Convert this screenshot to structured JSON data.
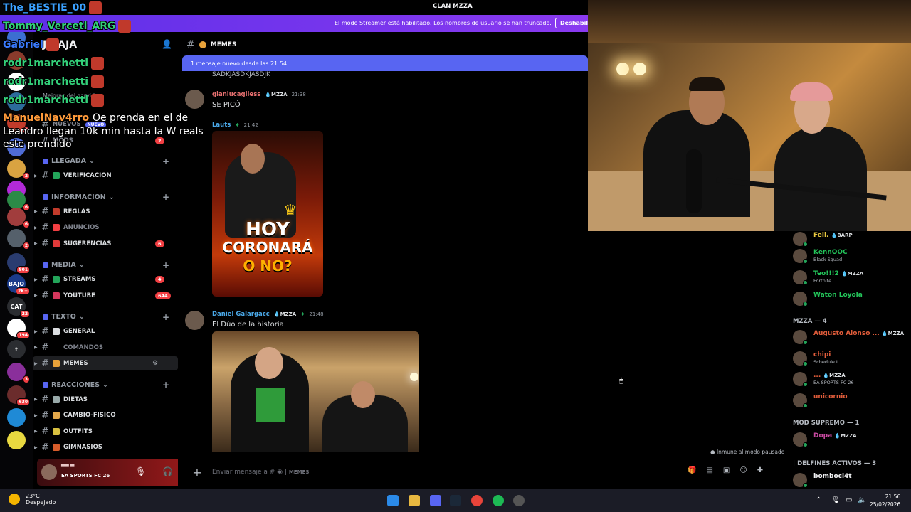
{
  "window": {
    "title": "CLAN MZZA"
  },
  "streamer_banner": {
    "message": "El modo Streamer está habilitado. Los nombres de usuario se han truncado.",
    "button": "Deshabili"
  },
  "server": {
    "name": "JAJAJA",
    "rail": [
      {
        "label": "",
        "badge": "",
        "color": "#3c6fd1"
      },
      {
        "label": "",
        "badge": "",
        "color": "#8a3b2c"
      },
      {
        "label": "",
        "badge": "",
        "color": "#ffffff"
      },
      {
        "label": "",
        "badge": "",
        "color": "#2c6b9b"
      },
      {
        "label": "",
        "badge": "6",
        "color": "#c23b2b"
      },
      {
        "label": "",
        "badge": "",
        "color": "#4f6cd6"
      },
      {
        "label": "",
        "badge": "2",
        "color": "#d9a341"
      },
      {
        "label": "",
        "badge": "",
        "color": "#b22ad8"
      },
      {
        "label": "",
        "badge": "6",
        "color": "#2b8a47"
      },
      {
        "label": "",
        "badge": "6",
        "color": "#a13d3d"
      },
      {
        "label": "",
        "badge": "2",
        "color": "#55606b"
      },
      {
        "label": "",
        "badge": "801",
        "color": "#2a3c70"
      },
      {
        "label": "BAJO",
        "badge": "2K+",
        "color": "#1b3b8a"
      },
      {
        "label": "CAT",
        "badge": "22",
        "color": "#2b2d31"
      },
      {
        "label": "",
        "badge": "194",
        "color": "#ffffff"
      },
      {
        "label": "t",
        "badge": "",
        "color": "#2b2d31"
      },
      {
        "label": "",
        "badge": "3",
        "color": "#8a2f9b"
      },
      {
        "label": "",
        "badge": "630",
        "color": "#6b2c2c"
      },
      {
        "label": "",
        "badge": "",
        "color": "#1f8ad6"
      },
      {
        "label": "",
        "badge": "",
        "color": "#e8d840"
      }
    ],
    "partial_rows": [
      "Mejoras del servidor"
    ],
    "categories": [
      {
        "name": "LLEGADA",
        "channels": [
          {
            "name": "VERIFICACION",
            "color": "#23a55a",
            "count": "",
            "dim": false
          }
        ]
      },
      {
        "name": "INFORMACION",
        "channels": [
          {
            "name": "REGLAS",
            "color": "#c23b2b",
            "count": "",
            "dim": false
          },
          {
            "name": "ANUNCIOS",
            "color": "#f23f43",
            "count": "",
            "dim": true
          },
          {
            "name": "SUGERENCIAS",
            "color": "#e03a3a",
            "count": "6",
            "dim": false
          }
        ]
      },
      {
        "name": "MEDIA",
        "channels": [
          {
            "name": "STREAMS",
            "color": "#23a55a",
            "count": "4",
            "dim": false
          },
          {
            "name": "YOUTUBE",
            "color": "#d4365c",
            "count": "644",
            "dim": false
          }
        ]
      },
      {
        "name": "TEXTO",
        "channels": [
          {
            "name": "GENERAL",
            "color": "#dbdee1",
            "count": "",
            "dim": false
          },
          {
            "name": "COMANDOS",
            "color": "#000000",
            "count": "",
            "dim": true
          },
          {
            "name": "MEMES",
            "color": "#e8a23a",
            "count": "",
            "dim": false
          }
        ]
      },
      {
        "name": "REACCIONES",
        "channels": [
          {
            "name": "DIETAS",
            "color": "#9aa",
            "count": "",
            "dim": false
          },
          {
            "name": "CAMBIO-FISICO",
            "color": "#e3a84a",
            "count": "",
            "dim": false
          },
          {
            "name": "OUTFITS",
            "color": "#d8c040",
            "count": "",
            "dim": false
          },
          {
            "name": "GIMNASIOS",
            "color": "#d65c2a",
            "count": "",
            "dim": false
          }
        ]
      }
    ],
    "extra_channels": [
      {
        "name": "NUEVOS",
        "badge": "NUEVO"
      },
      {
        "name": "MODS",
        "badge": "2"
      }
    ]
  },
  "user_panel": {
    "activity": "EA SPORTS FC 26"
  },
  "channel": {
    "name": "MEMES",
    "new_messages_bar": "1 mensaje nuevo desde las 21:54",
    "clipped_text": "SADKJASDKJASDJK",
    "composer_placeholder": "Enviar mensaje a #",
    "composer_channel": "MEMES"
  },
  "messages": [
    {
      "author": "gianlucagiless",
      "author_color": "#e87070",
      "tag": "MZZA",
      "time": "21:38",
      "text": "SE PICÓ"
    },
    {
      "author": "Lauts",
      "author_color": "#4aa8e8",
      "tag": "",
      "time": "21:42",
      "text": "",
      "image_text": [
        "HOY",
        "CORONARÁ",
        "O NO?"
      ]
    },
    {
      "author": "Daniel Galargacc",
      "author_color": "#4aa8e8",
      "tag": "MZZA",
      "time": "21:48",
      "text": "El Dúo de la historia"
    }
  ],
  "members": {
    "top": [
      {
        "name": "Feli.",
        "sub": "",
        "tag": "BARP",
        "color": "#e8c840"
      },
      {
        "name": "KennOOC",
        "sub": "Black Squad",
        "tag": "",
        "color": "#23c55a"
      },
      {
        "name": "Teo!!!2",
        "sub": "Fortnite",
        "tag": "MZZA",
        "color": "#23c55a"
      },
      {
        "name": "Waton Loyola",
        "sub": "",
        "tag": "",
        "color": "#23c55a"
      }
    ],
    "group_mzza": "MZZA — 4",
    "mzza": [
      {
        "name": "Augusto Alonso ...",
        "sub": "",
        "tag": "MZZA",
        "color": "#e05c3a"
      },
      {
        "name": "chipi",
        "sub": "Schedule I",
        "tag": "",
        "color": "#e05c3a"
      },
      {
        "name": "...",
        "sub": "EA SPORTS FC 26",
        "tag": "MZZA",
        "color": "#e05c3a"
      },
      {
        "name": "unicornio",
        "sub": "",
        "tag": "",
        "color": "#e05c3a"
      }
    ],
    "group_mod": "MOD SUPREMO — 1",
    "mod": [
      {
        "name": "Dopa",
        "sub": "",
        "tag": "MZZA",
        "color": "#c84aa0"
      }
    ],
    "group_delfines": "| DELFINES ACTIVOS — 3",
    "delfines": [
      {
        "name": "bombocl4t",
        "sub": "",
        "tag": "",
        "color": "#f2f3f5"
      }
    ]
  },
  "status_note": "Inmune al modo pausado",
  "chat_overlay": [
    {
      "user": "The_BESTIE_00",
      "color": "#3aa0ff",
      "text": ""
    },
    {
      "user": "Tommy_Verceti_ARG",
      "color": "#33d17a",
      "text": ""
    },
    {
      "user": "Gabriel",
      "color": "#3a7bff",
      "text": ""
    },
    {
      "user": "rodr1marchetti",
      "color": "#33d17a",
      "text": ""
    },
    {
      "user": "rodr1marchetti",
      "color": "#33d17a",
      "text": ""
    },
    {
      "user": "rodr1marchetti",
      "color": "#33d17a",
      "text": ""
    },
    {
      "user": "ManuelNav4rro",
      "color": "#ff9a3a",
      "text": "Oe prenda en el de"
    },
    {
      "user": "",
      "color": "#ffffff",
      "text": "Leandro llegan 10k min hasta la W reals"
    },
    {
      "user": "",
      "color": "#ffffff",
      "text": "este prendido"
    }
  ],
  "taskbar": {
    "weather_temp": "23°C",
    "weather_desc": "Despejado",
    "time": "21:56",
    "date": "25/02/2026"
  }
}
